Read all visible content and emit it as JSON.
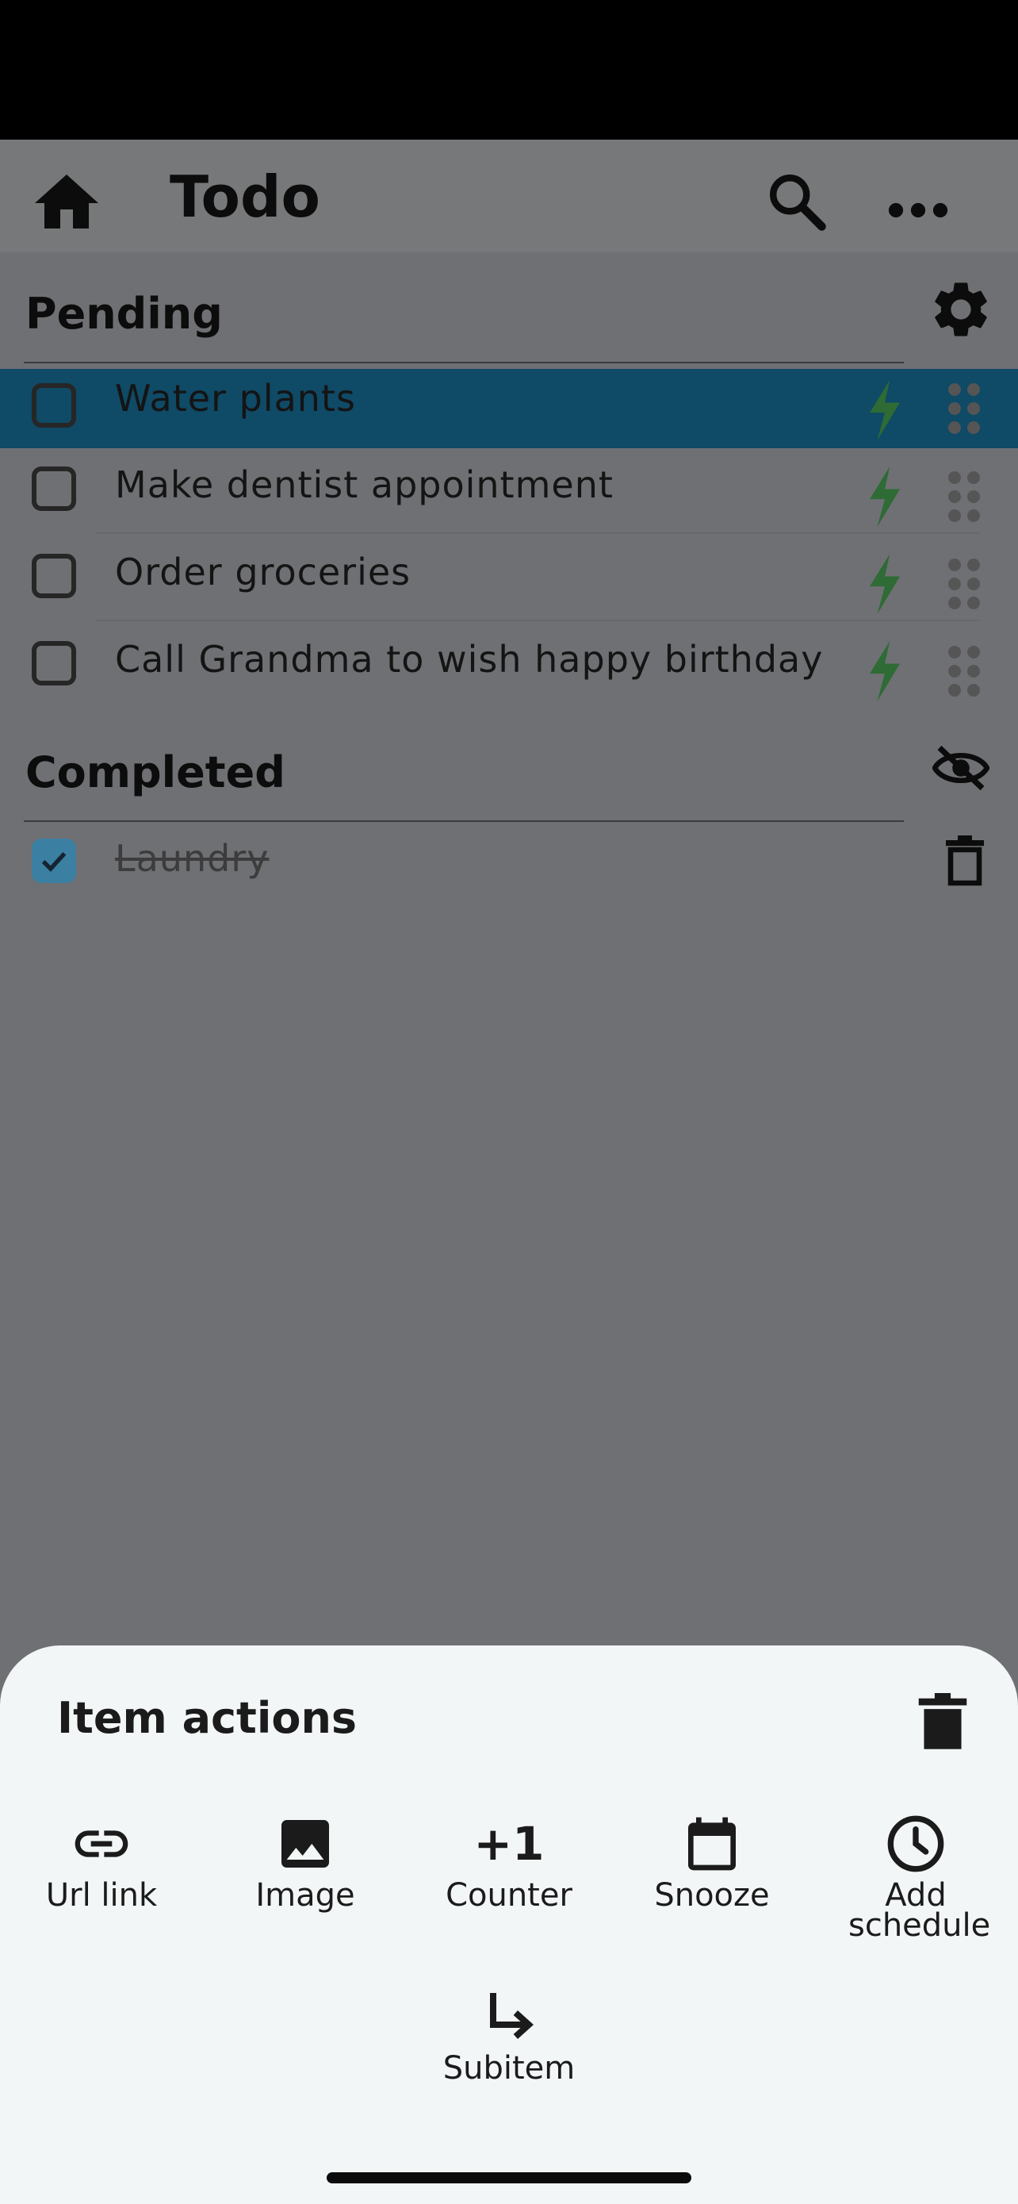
{
  "app": {
    "title": "Todo"
  },
  "sections": {
    "pending": {
      "title": "Pending",
      "items": [
        {
          "label": "Water plants",
          "selected": true
        },
        {
          "label": "Make dentist appointment",
          "selected": false
        },
        {
          "label": "Order groceries",
          "selected": false
        },
        {
          "label": "Call Grandma to wish happy birthday",
          "selected": false
        }
      ]
    },
    "completed": {
      "title": "Completed",
      "items": [
        {
          "label": "Laundry",
          "checked": true
        }
      ]
    }
  },
  "sheet": {
    "title": "Item actions",
    "actions": [
      {
        "label": "Url link",
        "icon": "link-icon"
      },
      {
        "label": "Image",
        "icon": "image-icon"
      },
      {
        "label": "Counter",
        "icon": "plus-one-icon",
        "glyph": "+1"
      },
      {
        "label": "Snooze",
        "icon": "calendar-icon"
      },
      {
        "label": "Add schedule",
        "icon": "clock-icon"
      },
      {
        "label": "Subitem",
        "icon": "subitem-arrow-icon"
      }
    ]
  },
  "colors": {
    "accent": "#3b7fa3",
    "selected_row": "#0f4a66",
    "bolt": "#2e6b35",
    "overlay": "#6f7073",
    "sheet": "#f3f6f7"
  }
}
